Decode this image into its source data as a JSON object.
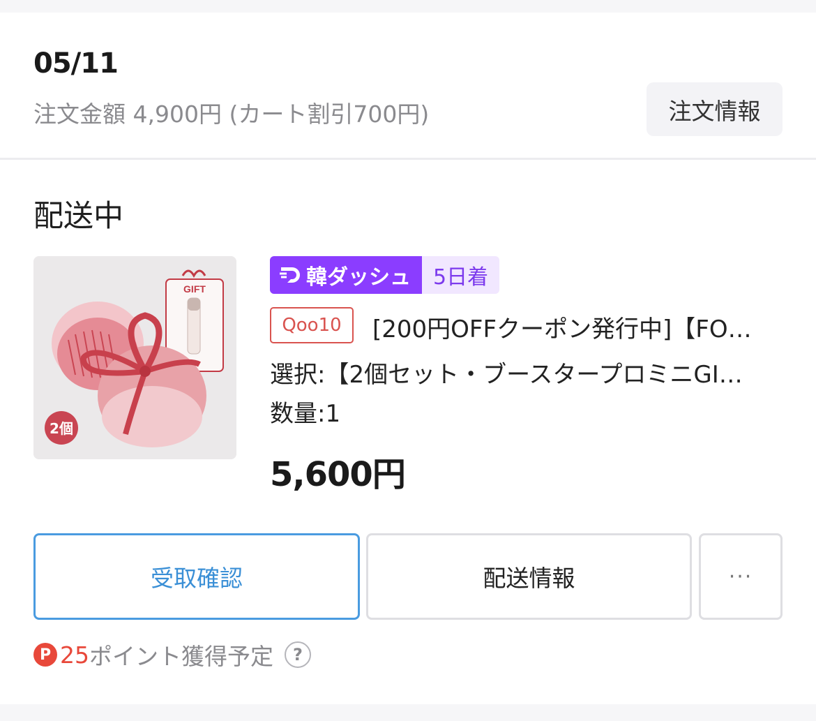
{
  "order": {
    "date": "05/11",
    "amount_text": "注文金額 4,900円 (カート割引700円)",
    "info_button": "注文情報"
  },
  "shipment": {
    "status": "配送中"
  },
  "product": {
    "image_gift_label": "GIFT",
    "image_count_label": "2個",
    "dash_badge": "韓ダッシュ",
    "delivery_days": "5日着",
    "shop_badge": "Qoo10",
    "title": "[200円OFFクーポン発行中]【FO…",
    "option": "選択:【2個セット・ブースタープロミニGI…",
    "quantity": "数量:1",
    "price": "5,600円"
  },
  "actions": {
    "confirm_label": "受取確認",
    "shipping_info_label": "配送情報",
    "more_label": "···"
  },
  "points": {
    "icon_letter": "P",
    "amount": "25",
    "text": "ポイント獲得予定",
    "help": "?"
  },
  "colors": {
    "dash_purple": "#8b3dff",
    "accent_blue": "#3a8fd6",
    "points_red": "#e8483a"
  }
}
